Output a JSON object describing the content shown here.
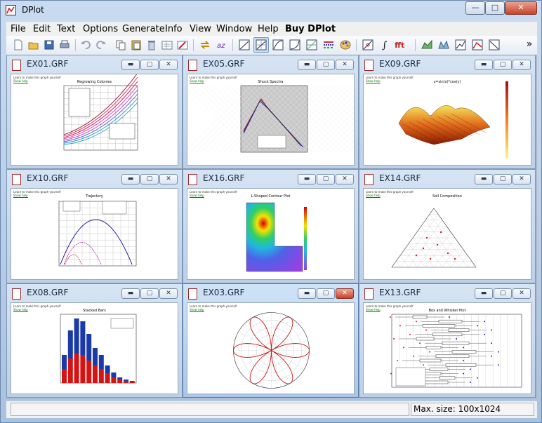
{
  "app": {
    "title": "DPlot"
  },
  "window_controls": {
    "minimize": "—",
    "maximize": "□",
    "close": "✕"
  },
  "menu": [
    "File",
    "Edit",
    "Text",
    "Options",
    "Generate",
    "Info",
    "View",
    "Window",
    "Help",
    "Buy DPlot"
  ],
  "toolbar": {
    "overflow": "»",
    "buttons": [
      "new-file-icon",
      "open-folder-icon",
      "save-icon",
      "print-icon",
      "undo-icon",
      "redo-icon",
      "copy-icon",
      "paste-icon",
      "delete-icon",
      "edit-data-icon",
      "edit-data2-icon",
      "swap-icon",
      "sort-az-icon",
      "axes-linear-icon",
      "axes-loglin-icon",
      "axes-linlog-icon",
      "axes-loglog-icon",
      "axes-grid-icon",
      "legend-icon",
      "palette-icon",
      "cross-hair-icon",
      "integral-icon",
      "fft-icon",
      "surface-3d-icon",
      "surface-3d-2-icon",
      "trend-icon",
      "bars-trend-icon",
      "linear-fit-icon"
    ]
  },
  "mdi_controls": {
    "minimize": "▬",
    "restore": "▢",
    "close": "✕"
  },
  "plot_caption": {
    "line1": "Learn to make this graph yourself",
    "line2": "Show help"
  },
  "windows": [
    {
      "id": "ex01",
      "title": "EX01.GRF",
      "plot_title": "Regrowing Colonies",
      "kind": "curves"
    },
    {
      "id": "ex05",
      "title": "EX05.GRF",
      "plot_title": "Shock Spectra",
      "kind": "shock"
    },
    {
      "id": "ex09",
      "title": "EX09.GRF",
      "plot_title": "z=sin(x)*cos(y)",
      "kind": "surface"
    },
    {
      "id": "ex10",
      "title": "EX10.GRF",
      "plot_title": "Trajectory",
      "kind": "trajectory"
    },
    {
      "id": "ex16",
      "title": "EX16.GRF",
      "plot_title": "L-Shaped Contour Plot",
      "kind": "contour"
    },
    {
      "id": "ex14",
      "title": "EX14.GRF",
      "plot_title": "Soil Composition",
      "kind": "ternary"
    },
    {
      "id": "ex08",
      "title": "EX08.GRF",
      "plot_title": "Stacked Bars",
      "kind": "bars"
    },
    {
      "id": "ex03",
      "title": "EX03.GRF",
      "plot_title": "",
      "kind": "polar"
    },
    {
      "id": "ex13",
      "title": "EX13.GRF",
      "plot_title": "Box and Whisker Plot",
      "kind": "boxplot"
    }
  ],
  "status": {
    "left": "",
    "right": "Max. size: 100x1024"
  }
}
